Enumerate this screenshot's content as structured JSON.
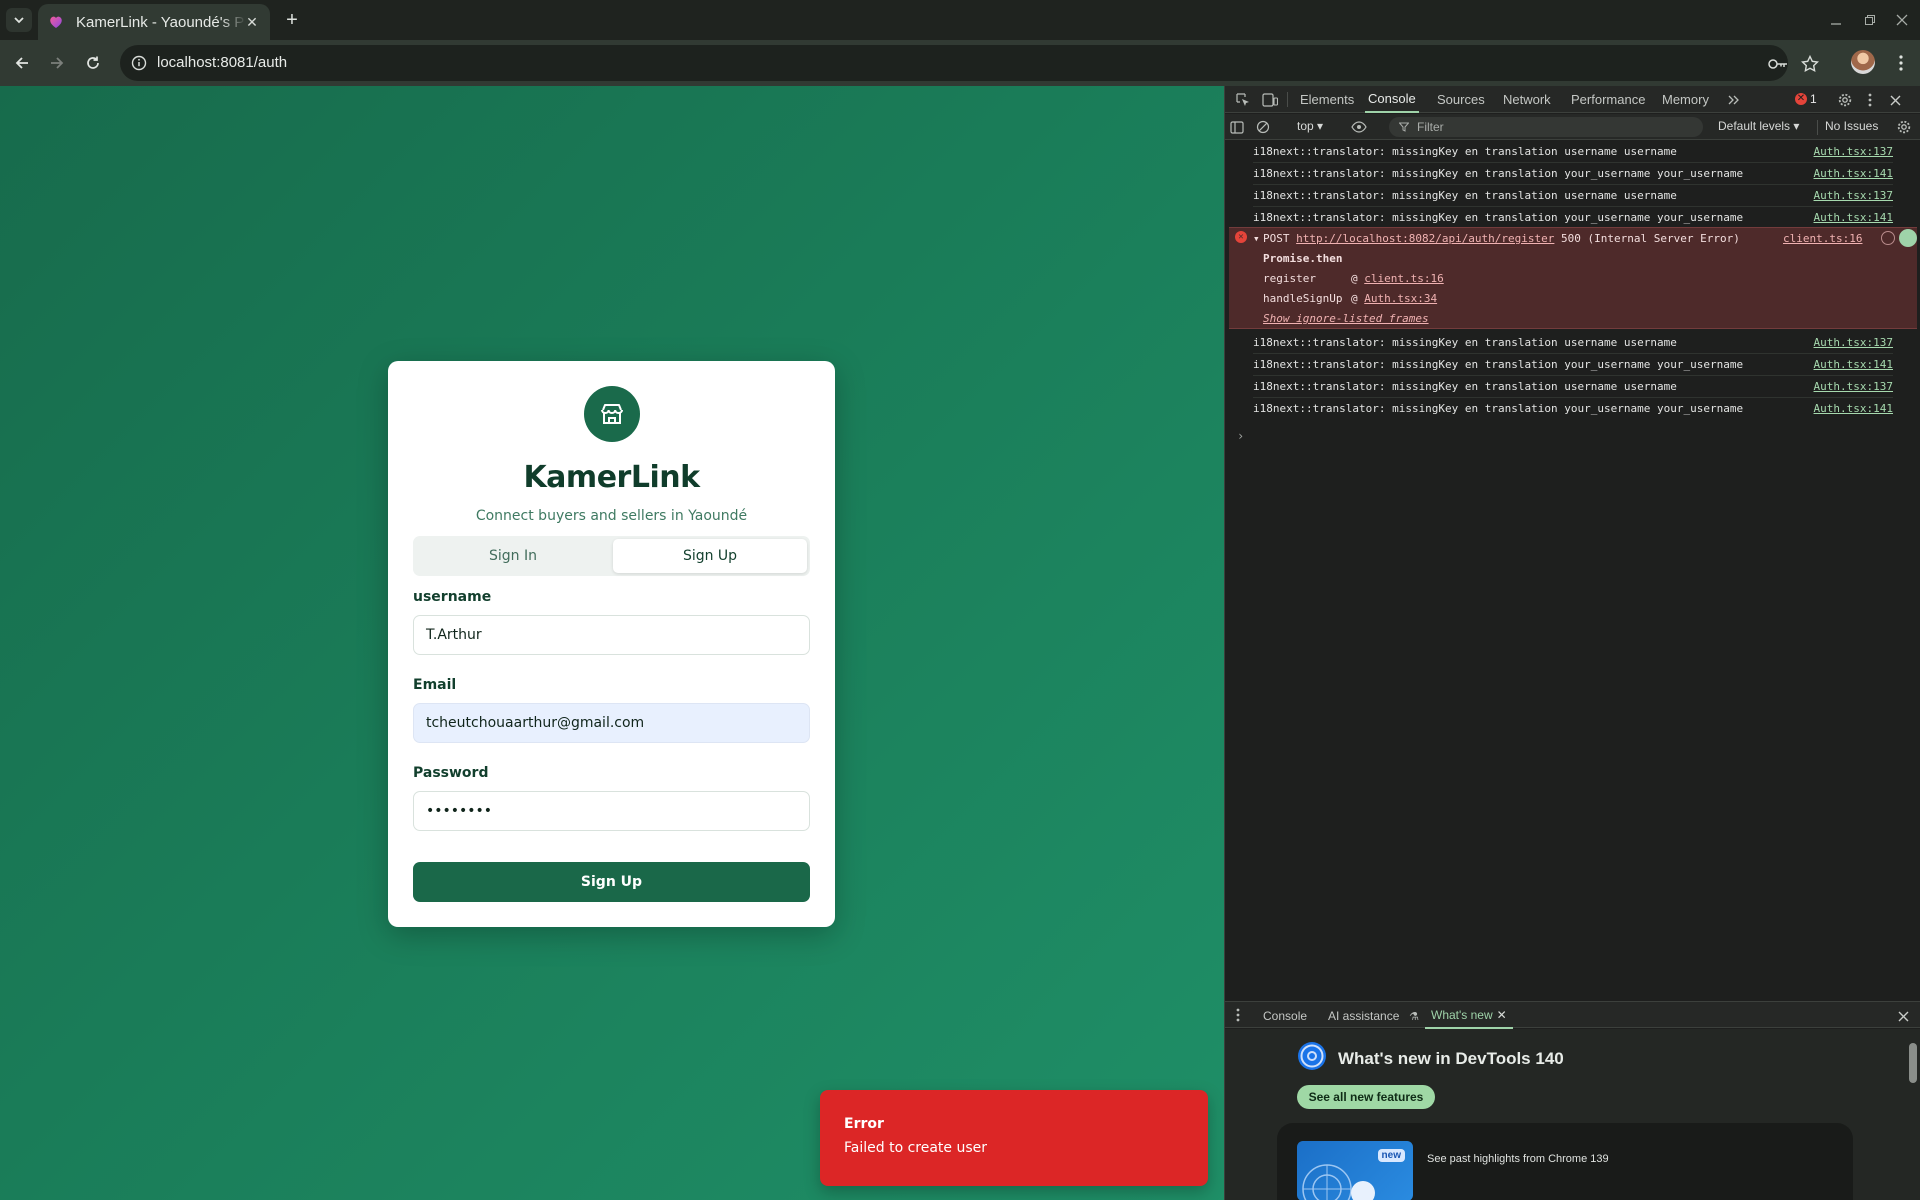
{
  "browser": {
    "tab_title": "KamerLink - Yaoundé's P",
    "url": "localhost:8081/auth"
  },
  "app": {
    "brand": "KamerLink",
    "tagline": "Connect buyers and sellers in Yaoundé",
    "tabs": {
      "signin": "Sign In",
      "signup": "Sign Up"
    },
    "fields": {
      "username_label": "username",
      "username_value": "T.Arthur",
      "email_label": "Email",
      "email_value": "tcheutchouaarthur@gmail.com",
      "password_label": "Password",
      "password_value": "••••••••"
    },
    "submit_label": "Sign Up",
    "accent_color": "#1a6849"
  },
  "toast": {
    "title": "Error",
    "message": "Failed to create user",
    "color": "#dc2626"
  },
  "devtools": {
    "tabs": [
      "Elements",
      "Console",
      "Sources",
      "Network",
      "Performance",
      "Memory"
    ],
    "active_tab": "Console",
    "error_count": "1",
    "context": "top",
    "filter_placeholder": "Filter",
    "levels": "Default levels",
    "issues": "No Issues",
    "logs_before": [
      {
        "text": "i18next::translator: missingKey en translation username username",
        "src": "Auth.tsx:137"
      },
      {
        "text": "i18next::translator: missingKey en translation your_username your_username",
        "src": "Auth.tsx:141"
      },
      {
        "text": "i18next::translator: missingKey en translation username username",
        "src": "Auth.tsx:137"
      },
      {
        "text": "i18next::translator: missingKey en translation your_username your_username",
        "src": "Auth.tsx:141"
      }
    ],
    "error": {
      "method": "POST",
      "url": "http://localhost:8082/api/auth/register",
      "status": "500 (Internal Server Error)",
      "src": "client.ts:16",
      "promise": "Promise.then",
      "frame1_fn": "register",
      "frame1_src": "client.ts:16",
      "frame2_fn": "handleSignUp",
      "frame2_src": "Auth.tsx:34",
      "show_frames": "Show ignore-listed frames"
    },
    "logs_after": [
      {
        "text": "i18next::translator: missingKey en translation username username",
        "src": "Auth.tsx:137"
      },
      {
        "text": "i18next::translator: missingKey en translation your_username your_username",
        "src": "Auth.tsx:141"
      },
      {
        "text": "i18next::translator: missingKey en translation username username",
        "src": "Auth.tsx:137"
      },
      {
        "text": "i18next::translator: missingKey en translation your_username your_username",
        "src": "Auth.tsx:141"
      }
    ],
    "drawer_tabs": [
      "Console",
      "AI assistance",
      "What's new"
    ],
    "whats_new": {
      "title": "What's new in DevTools 140",
      "button": "See all new features",
      "badge": "new",
      "highlight": "See past highlights from Chrome 139"
    }
  }
}
